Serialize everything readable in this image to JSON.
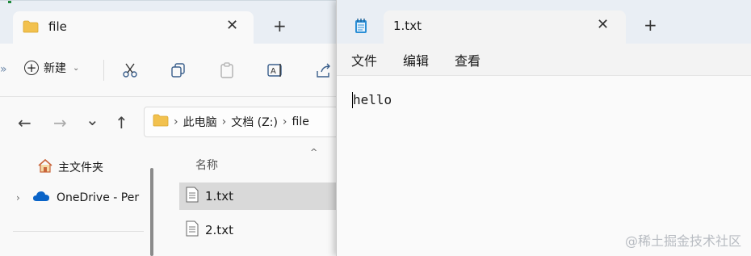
{
  "explorer": {
    "tab_title": "file",
    "new_tab_symbol": "+",
    "close_symbol": "✕",
    "toolbar": {
      "new_label": "新建",
      "icons": [
        "cut-icon",
        "copy-icon",
        "paste-icon",
        "rename-icon",
        "share-icon"
      ]
    },
    "nav": {
      "back": "←",
      "forward": "→",
      "recent": "⌄",
      "up": "↑"
    },
    "address": {
      "segments": [
        "此电脑",
        "文档 (Z:)",
        "file"
      ],
      "separator": "›"
    },
    "sidebar": {
      "home": "主文件夹",
      "onedrive": "OneDrive - Per"
    },
    "list": {
      "column_name": "名称",
      "files": [
        {
          "name": "1.txt",
          "selected": true
        },
        {
          "name": "2.txt",
          "selected": false
        }
      ]
    }
  },
  "notepad": {
    "tab_title": "1.txt",
    "close_symbol": "✕",
    "new_tab_symbol": "+",
    "menu": [
      "文件",
      "编辑",
      "查看"
    ],
    "content": "hello"
  },
  "watermark": "@稀土掘金技术社区",
  "colors": {
    "folder": "#f2c14e",
    "onedrive": "#0a64c8",
    "accent": "#0067c0"
  }
}
